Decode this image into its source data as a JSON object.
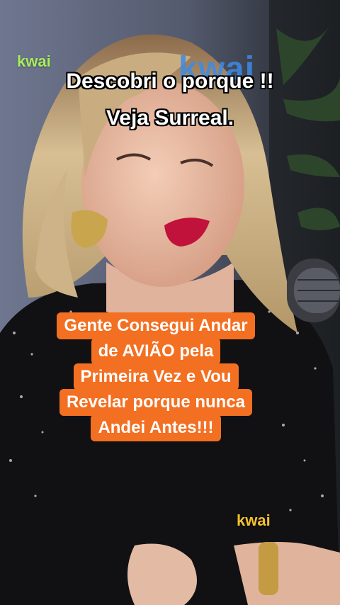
{
  "watermarks": {
    "top_left": "kwai",
    "background": "kwai",
    "bottom_right": "kwai"
  },
  "caption_top": {
    "line1": "Descobri o porque !!",
    "line2": "Veja Surreal."
  },
  "caption_box": {
    "lines": [
      "Gente Consegui Andar",
      "de AVIÃO pela",
      "Primeira Vez e Vou",
      "Revelar porque nunca",
      "Andei Antes!!!"
    ]
  },
  "colors": {
    "caption_box_bg": "#f36f21",
    "watermark_green": "#a8ee5b",
    "watermark_yellow": "#f2c12e",
    "watermark_blue": "#3d8be6"
  }
}
